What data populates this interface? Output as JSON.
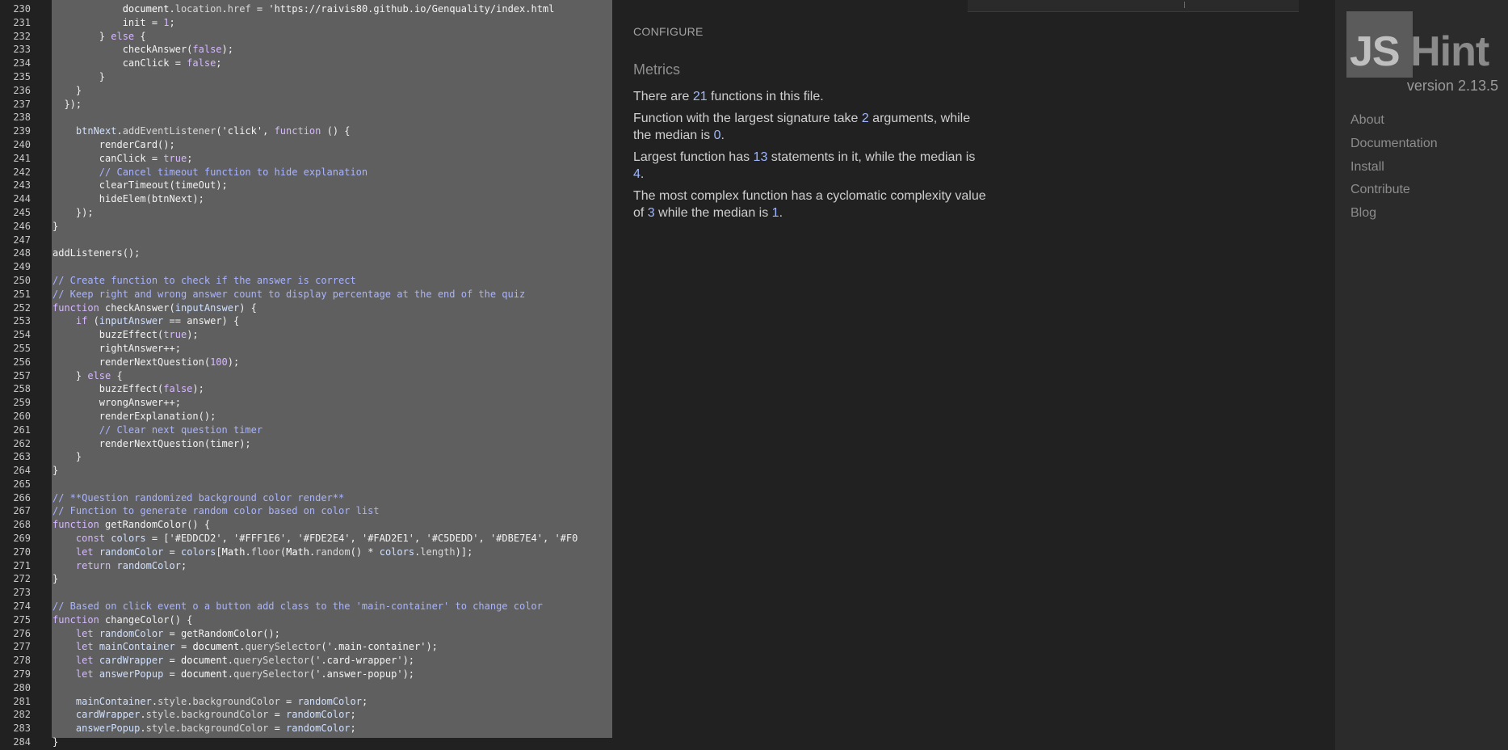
{
  "editor": {
    "lines": [
      {
        "n": "230",
        "code": [
          [
            "",
            "            "
          ],
          [
            "fn",
            "document"
          ],
          [
            "",
            "."
          ],
          [
            "pr",
            "location"
          ],
          [
            "",
            "."
          ],
          [
            "pr",
            "href"
          ],
          [
            "",
            " = "
          ],
          [
            "st",
            "'https://raivis80.github.io/Genquality/index.html"
          ]
        ]
      },
      {
        "n": "231",
        "code": [
          [
            "",
            "            init = "
          ],
          [
            "nu",
            "1"
          ],
          [
            "",
            ";"
          ]
        ]
      },
      {
        "n": "232",
        "code": [
          [
            "",
            "        } "
          ],
          [
            "kw",
            "else"
          ],
          [
            "",
            " {"
          ]
        ]
      },
      {
        "n": "233",
        "code": [
          [
            "",
            "            checkAnswer("
          ],
          [
            "bl",
            "false"
          ],
          [
            "",
            ");"
          ]
        ]
      },
      {
        "n": "234",
        "code": [
          [
            "",
            "            canClick = "
          ],
          [
            "bl",
            "false"
          ],
          [
            "",
            ";"
          ]
        ]
      },
      {
        "n": "235",
        "code": [
          [
            "",
            "        }"
          ]
        ]
      },
      {
        "n": "236",
        "code": [
          [
            "",
            "    }"
          ]
        ]
      },
      {
        "n": "237",
        "code": [
          [
            "",
            "  });"
          ]
        ]
      },
      {
        "n": "238",
        "code": []
      },
      {
        "n": "239",
        "code": [
          [
            "",
            "    "
          ],
          [
            "vr",
            "btnNext"
          ],
          [
            "",
            "."
          ],
          [
            "pr",
            "addEventListener"
          ],
          [
            "",
            "("
          ],
          [
            "st",
            "'click'"
          ],
          [
            "",
            ", "
          ],
          [
            "kw",
            "function"
          ],
          [
            "",
            " () {"
          ]
        ]
      },
      {
        "n": "240",
        "code": [
          [
            "",
            "        renderCard();"
          ]
        ]
      },
      {
        "n": "241",
        "code": [
          [
            "",
            "        canClick = "
          ],
          [
            "bl",
            "true"
          ],
          [
            "",
            ";"
          ]
        ]
      },
      {
        "n": "242",
        "code": [
          [
            "",
            "        "
          ],
          [
            "cm",
            "// Cancel timeout function to hide explanation"
          ]
        ]
      },
      {
        "n": "243",
        "code": [
          [
            "",
            "        clearTimeout(timeOut);"
          ]
        ]
      },
      {
        "n": "244",
        "code": [
          [
            "",
            "        hideElem(btnNext);"
          ]
        ]
      },
      {
        "n": "245",
        "code": [
          [
            "",
            "    });"
          ]
        ]
      },
      {
        "n": "246",
        "code": [
          [
            "",
            "}"
          ]
        ]
      },
      {
        "n": "247",
        "code": []
      },
      {
        "n": "248",
        "code": [
          [
            "",
            "addListeners();"
          ]
        ]
      },
      {
        "n": "249",
        "code": []
      },
      {
        "n": "250",
        "code": [
          [
            "cm",
            "// Create function to check if the answer is correct"
          ]
        ]
      },
      {
        "n": "251",
        "code": [
          [
            "cm",
            "// Keep right and wrong answer count to display percentage at the end of the quiz"
          ]
        ]
      },
      {
        "n": "252",
        "code": [
          [
            "kw",
            "function"
          ],
          [
            "",
            " checkAnswer("
          ],
          [
            "vr",
            "inputAnswer"
          ],
          [
            "",
            ") {"
          ]
        ]
      },
      {
        "n": "253",
        "code": [
          [
            "",
            "    "
          ],
          [
            "kw",
            "if"
          ],
          [
            "",
            " ("
          ],
          [
            "vr",
            "inputAnswer"
          ],
          [
            "",
            " == answer) {"
          ]
        ]
      },
      {
        "n": "254",
        "code": [
          [
            "",
            "        buzzEffect("
          ],
          [
            "bl",
            "true"
          ],
          [
            "",
            ");"
          ]
        ]
      },
      {
        "n": "255",
        "code": [
          [
            "",
            "        rightAnswer++;"
          ]
        ]
      },
      {
        "n": "256",
        "code": [
          [
            "",
            "        renderNextQuestion("
          ],
          [
            "nu",
            "100"
          ],
          [
            "",
            ");"
          ]
        ]
      },
      {
        "n": "257",
        "code": [
          [
            "",
            "    } "
          ],
          [
            "kw",
            "else"
          ],
          [
            "",
            " {"
          ]
        ]
      },
      {
        "n": "258",
        "code": [
          [
            "",
            "        buzzEffect("
          ],
          [
            "bl",
            "false"
          ],
          [
            "",
            ");"
          ]
        ]
      },
      {
        "n": "259",
        "code": [
          [
            "",
            "        wrongAnswer++;"
          ]
        ]
      },
      {
        "n": "260",
        "code": [
          [
            "",
            "        renderExplanation();"
          ]
        ]
      },
      {
        "n": "261",
        "code": [
          [
            "",
            "        "
          ],
          [
            "cm",
            "// Clear next question timer"
          ]
        ]
      },
      {
        "n": "262",
        "code": [
          [
            "",
            "        renderNextQuestion(timer);"
          ]
        ]
      },
      {
        "n": "263",
        "code": [
          [
            "",
            "    }"
          ]
        ]
      },
      {
        "n": "264",
        "code": [
          [
            "",
            "}"
          ]
        ]
      },
      {
        "n": "265",
        "code": []
      },
      {
        "n": "266",
        "code": [
          [
            "cm",
            "// **Question randomized background color render**"
          ]
        ]
      },
      {
        "n": "267",
        "code": [
          [
            "cm",
            "// Function to generate random color based on color list"
          ]
        ]
      },
      {
        "n": "268",
        "code": [
          [
            "kw",
            "function"
          ],
          [
            "",
            " getRandomColor() {"
          ]
        ]
      },
      {
        "n": "269",
        "code": [
          [
            "",
            "    "
          ],
          [
            "kw",
            "const"
          ],
          [
            "",
            " "
          ],
          [
            "vr",
            "colors"
          ],
          [
            "",
            " = ["
          ],
          [
            "st",
            "'#EDDCD2'"
          ],
          [
            "",
            ", "
          ],
          [
            "st",
            "'#FFF1E6'"
          ],
          [
            "",
            ", "
          ],
          [
            "st",
            "'#FDE2E4'"
          ],
          [
            "",
            ", "
          ],
          [
            "st",
            "'#FAD2E1'"
          ],
          [
            "",
            ", "
          ],
          [
            "st",
            "'#C5DEDD'"
          ],
          [
            "",
            ", "
          ],
          [
            "st",
            "'#DBE7E4'"
          ],
          [
            "",
            ", "
          ],
          [
            "st",
            "'#F0"
          ]
        ]
      },
      {
        "n": "270",
        "code": [
          [
            "",
            "    "
          ],
          [
            "kw",
            "let"
          ],
          [
            "",
            " "
          ],
          [
            "vr",
            "randomColor"
          ],
          [
            "",
            " = "
          ],
          [
            "vr",
            "colors"
          ],
          [
            "",
            "["
          ],
          [
            "fn",
            "Math"
          ],
          [
            "",
            "."
          ],
          [
            "pr",
            "floor"
          ],
          [
            "",
            "("
          ],
          [
            "fn",
            "Math"
          ],
          [
            "",
            "."
          ],
          [
            "pr",
            "random"
          ],
          [
            "",
            "() * "
          ],
          [
            "vr",
            "colors"
          ],
          [
            "",
            "."
          ],
          [
            "pr",
            "length"
          ],
          [
            "",
            ")];"
          ]
        ]
      },
      {
        "n": "271",
        "code": [
          [
            "",
            "    "
          ],
          [
            "kw",
            "return"
          ],
          [
            "",
            " "
          ],
          [
            "vr",
            "randomColor"
          ],
          [
            "",
            ";"
          ]
        ]
      },
      {
        "n": "272",
        "code": [
          [
            "",
            "}"
          ]
        ]
      },
      {
        "n": "273",
        "code": []
      },
      {
        "n": "274",
        "code": [
          [
            "cm",
            "// Based on click event o a button add class to the 'main-container' to change color"
          ]
        ]
      },
      {
        "n": "275",
        "code": [
          [
            "kw",
            "function"
          ],
          [
            "",
            " changeColor() {"
          ]
        ]
      },
      {
        "n": "276",
        "code": [
          [
            "",
            "    "
          ],
          [
            "kw",
            "let"
          ],
          [
            "",
            " "
          ],
          [
            "vr",
            "randomColor"
          ],
          [
            "",
            " = getRandomColor();"
          ]
        ]
      },
      {
        "n": "277",
        "code": [
          [
            "",
            "    "
          ],
          [
            "kw",
            "let"
          ],
          [
            "",
            " "
          ],
          [
            "vr",
            "mainContainer"
          ],
          [
            "",
            " = "
          ],
          [
            "fn",
            "document"
          ],
          [
            "",
            "."
          ],
          [
            "pr",
            "querySelector"
          ],
          [
            "",
            "("
          ],
          [
            "st",
            "'.main-container'"
          ],
          [
            "",
            ");"
          ]
        ]
      },
      {
        "n": "278",
        "code": [
          [
            "",
            "    "
          ],
          [
            "kw",
            "let"
          ],
          [
            "",
            " "
          ],
          [
            "vr",
            "cardWrapper"
          ],
          [
            "",
            " = "
          ],
          [
            "fn",
            "document"
          ],
          [
            "",
            "."
          ],
          [
            "pr",
            "querySelector"
          ],
          [
            "",
            "("
          ],
          [
            "st",
            "'.card-wrapper'"
          ],
          [
            "",
            ");"
          ]
        ]
      },
      {
        "n": "279",
        "code": [
          [
            "",
            "    "
          ],
          [
            "kw",
            "let"
          ],
          [
            "",
            " "
          ],
          [
            "vr",
            "answerPopup"
          ],
          [
            "",
            " = "
          ],
          [
            "fn",
            "document"
          ],
          [
            "",
            "."
          ],
          [
            "pr",
            "querySelector"
          ],
          [
            "",
            "("
          ],
          [
            "st",
            "'.answer-popup'"
          ],
          [
            "",
            ");"
          ]
        ]
      },
      {
        "n": "280",
        "code": []
      },
      {
        "n": "281",
        "code": [
          [
            "",
            "    "
          ],
          [
            "vr",
            "mainContainer"
          ],
          [
            "",
            "."
          ],
          [
            "pr",
            "style"
          ],
          [
            "",
            "."
          ],
          [
            "pr",
            "backgroundColor"
          ],
          [
            "",
            " = "
          ],
          [
            "vr",
            "randomColor"
          ],
          [
            "",
            ";"
          ]
        ]
      },
      {
        "n": "282",
        "code": [
          [
            "",
            "    "
          ],
          [
            "vr",
            "cardWrapper"
          ],
          [
            "",
            "."
          ],
          [
            "pr",
            "style"
          ],
          [
            "",
            "."
          ],
          [
            "pr",
            "backgroundColor"
          ],
          [
            "",
            " = "
          ],
          [
            "vr",
            "randomColor"
          ],
          [
            "",
            ";"
          ]
        ]
      },
      {
        "n": "283",
        "code": [
          [
            "",
            "    "
          ],
          [
            "vr",
            "answerPopup"
          ],
          [
            "",
            "."
          ],
          [
            "pr",
            "style"
          ],
          [
            "",
            "."
          ],
          [
            "pr",
            "backgroundColor"
          ],
          [
            "",
            " = "
          ],
          [
            "vr",
            "randomColor"
          ],
          [
            "",
            ";"
          ]
        ]
      },
      {
        "n": "284",
        "code": [
          [
            "",
            "}"
          ]
        ]
      }
    ]
  },
  "report": {
    "configure_label": "CONFIGURE",
    "metrics_title": "Metrics",
    "metrics": {
      "functions_pre": "There are ",
      "functions_count": "21",
      "functions_post": " functions in this file.",
      "signature_pre": "Function with the largest signature take ",
      "signature_max": "2",
      "signature_mid": " arguments, while the median is ",
      "signature_median": "0",
      "signature_post": ".",
      "statements_pre": "Largest function has ",
      "statements_max": "13",
      "statements_mid": " statements in it, while the median is ",
      "statements_median": "4",
      "statements_post": ".",
      "complexity_pre": "The most complex function has a cyclomatic complexity value of ",
      "complexity_max": "3",
      "complexity_mid": " while the median is ",
      "complexity_median": "1",
      "complexity_post": "."
    }
  },
  "sidebar": {
    "logo_j": "JS",
    "logo_rest": "Hint",
    "version": "version 2.13.5",
    "nav": [
      "About",
      "Documentation",
      "Install",
      "Contribute",
      "Blog"
    ]
  },
  "colors": {
    "page_bg": "#212121",
    "code_selection": "#5f5f5f",
    "sidebar_bg": "#2b2b2b",
    "number_accent": "#9fb7ff"
  }
}
